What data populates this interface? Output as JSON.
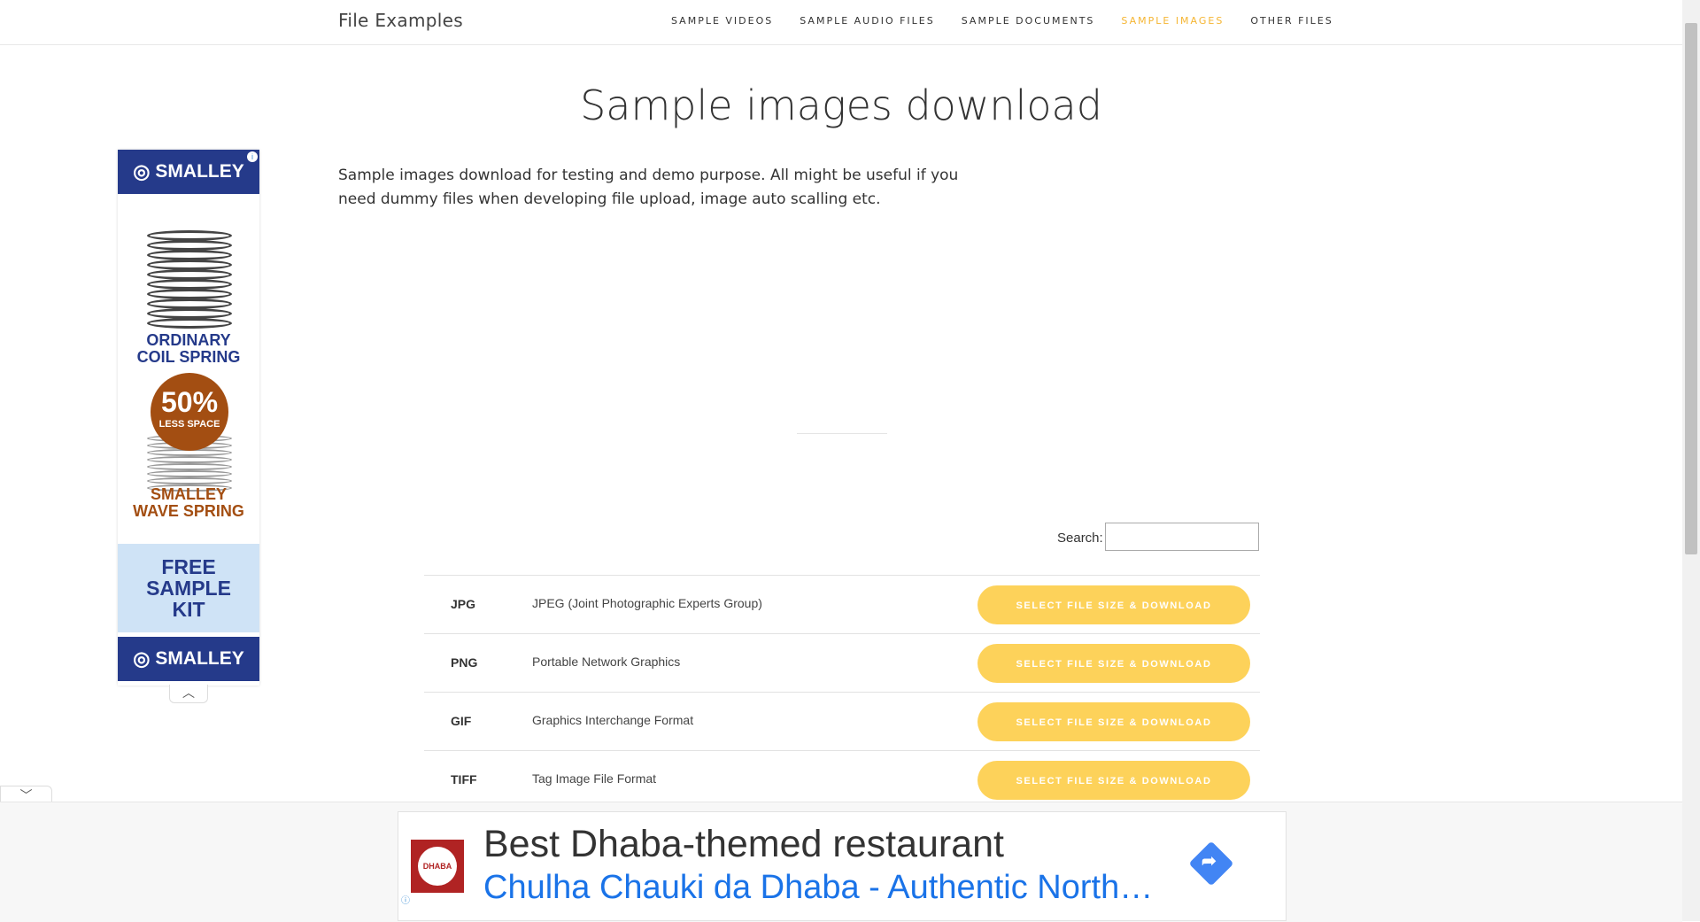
{
  "header": {
    "logo": "File Examples",
    "nav": [
      {
        "label": "SAMPLE VIDEOS"
      },
      {
        "label": "SAMPLE AUDIO FILES"
      },
      {
        "label": "SAMPLE DOCUMENTS"
      },
      {
        "label": "SAMPLE IMAGES",
        "active": true
      },
      {
        "label": "OTHER FILES"
      }
    ],
    "active_color": "#f5b532"
  },
  "page": {
    "title": "Sample images download",
    "intro": "Sample images download for testing and demo purpose. All might be useful if you need dummy files when developing file upload, image auto scalling etc."
  },
  "side_ad": {
    "brand": "SMALLEY",
    "line1a": "ORDINARY",
    "line1b": "COIL SPRING",
    "badge_pct": "50%",
    "badge_text": "LESS SPACE",
    "line2a": "SMALLEY",
    "line2b": "WAVE SPRING",
    "kit1": "FREE",
    "kit2": "SAMPLE",
    "kit3": "KIT",
    "collapse_glyph": "︿"
  },
  "search": {
    "label": "Search:",
    "value": ""
  },
  "table": {
    "button_label": "SELECT FILE SIZE & DOWNLOAD",
    "rows": [
      {
        "ext": "JPG",
        "desc": "JPEG (Joint Photographic Experts Group)"
      },
      {
        "ext": "PNG",
        "desc": "Portable Network Graphics"
      },
      {
        "ext": "GIF",
        "desc": "Graphics Interchange Format"
      },
      {
        "ext": "TIFF",
        "desc": "Tag Image File Format"
      }
    ],
    "button_color": "#fdd25a"
  },
  "bottom_ad": {
    "headline": "Best Dhaba-themed restaurant",
    "subline": "Chulha Chauki da Dhaba - Authentic North…",
    "toggle_glyph": "﹀",
    "link_color": "#1a73e8"
  }
}
